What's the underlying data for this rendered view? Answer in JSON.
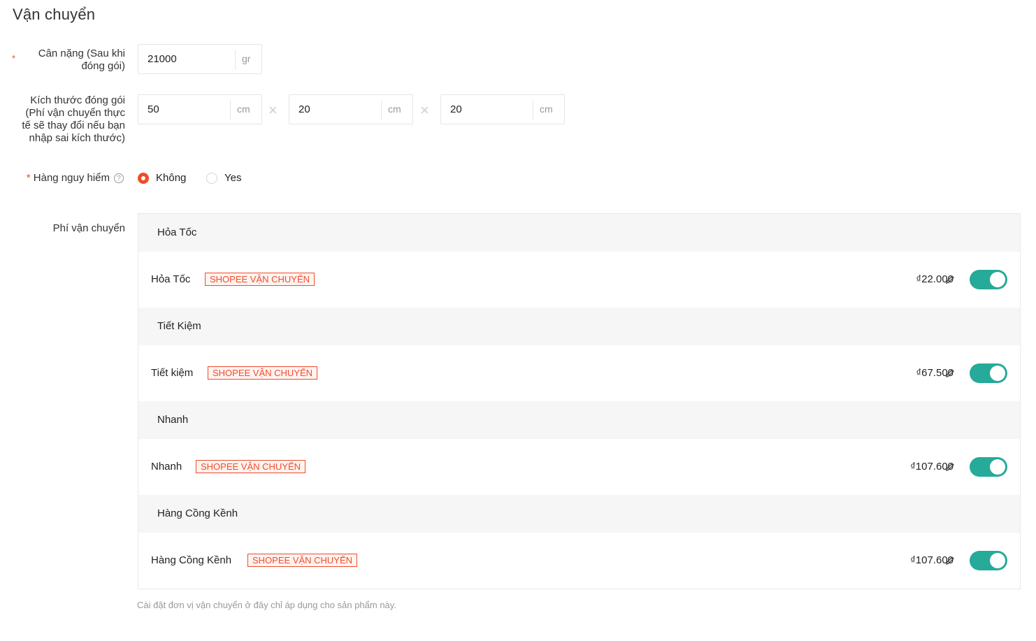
{
  "title": "Vận chuyển",
  "weight": {
    "label_line1": "Cân nặng (Sau khi",
    "label_line2": "đóng gói)",
    "value": "21000",
    "unit": "gr"
  },
  "dimensions": {
    "label_lines": [
      "Kích thước đóng gói",
      "(Phí vận chuyển thực",
      "tế sẽ thay đổi nếu bạn",
      "nhập sai kích thước)"
    ],
    "length": "50",
    "width": "20",
    "height": "20",
    "unit": "cm"
  },
  "dangerous": {
    "label": "Hàng nguy hiểm",
    "option_no": "Không",
    "option_yes": "Yes",
    "selected": "Không"
  },
  "shipping_fee": {
    "label": "Phí vận chuyển",
    "groups": [
      {
        "header": "Hỏa Tốc",
        "name": "Hỏa Tốc",
        "tag": "SHOPEE VẬN CHUYỂN",
        "price": "₫22.000",
        "enabled": true
      },
      {
        "header": "Tiết Kiệm",
        "name": "Tiết kiệm",
        "tag": "SHOPEE VẬN CHUYỂN",
        "price": "₫67.500",
        "enabled": true
      },
      {
        "header": "Nhanh",
        "name": "Nhanh",
        "tag": "SHOPEE VẬN CHUYỂN",
        "price": "₫107.600",
        "enabled": true
      },
      {
        "header": "Hàng Cồng Kềnh",
        "name": "Hàng Cồng Kềnh",
        "tag": "SHOPEE VẬN CHUYỂN",
        "price": "₫107.600",
        "enabled": true
      }
    ]
  },
  "note": "Cài đặt đơn vị vận chuyển ở đây chỉ áp dụng cho sản phẩm này.",
  "colors": {
    "accent": "#ee4d2d",
    "toggle_on": "#26aa99"
  }
}
